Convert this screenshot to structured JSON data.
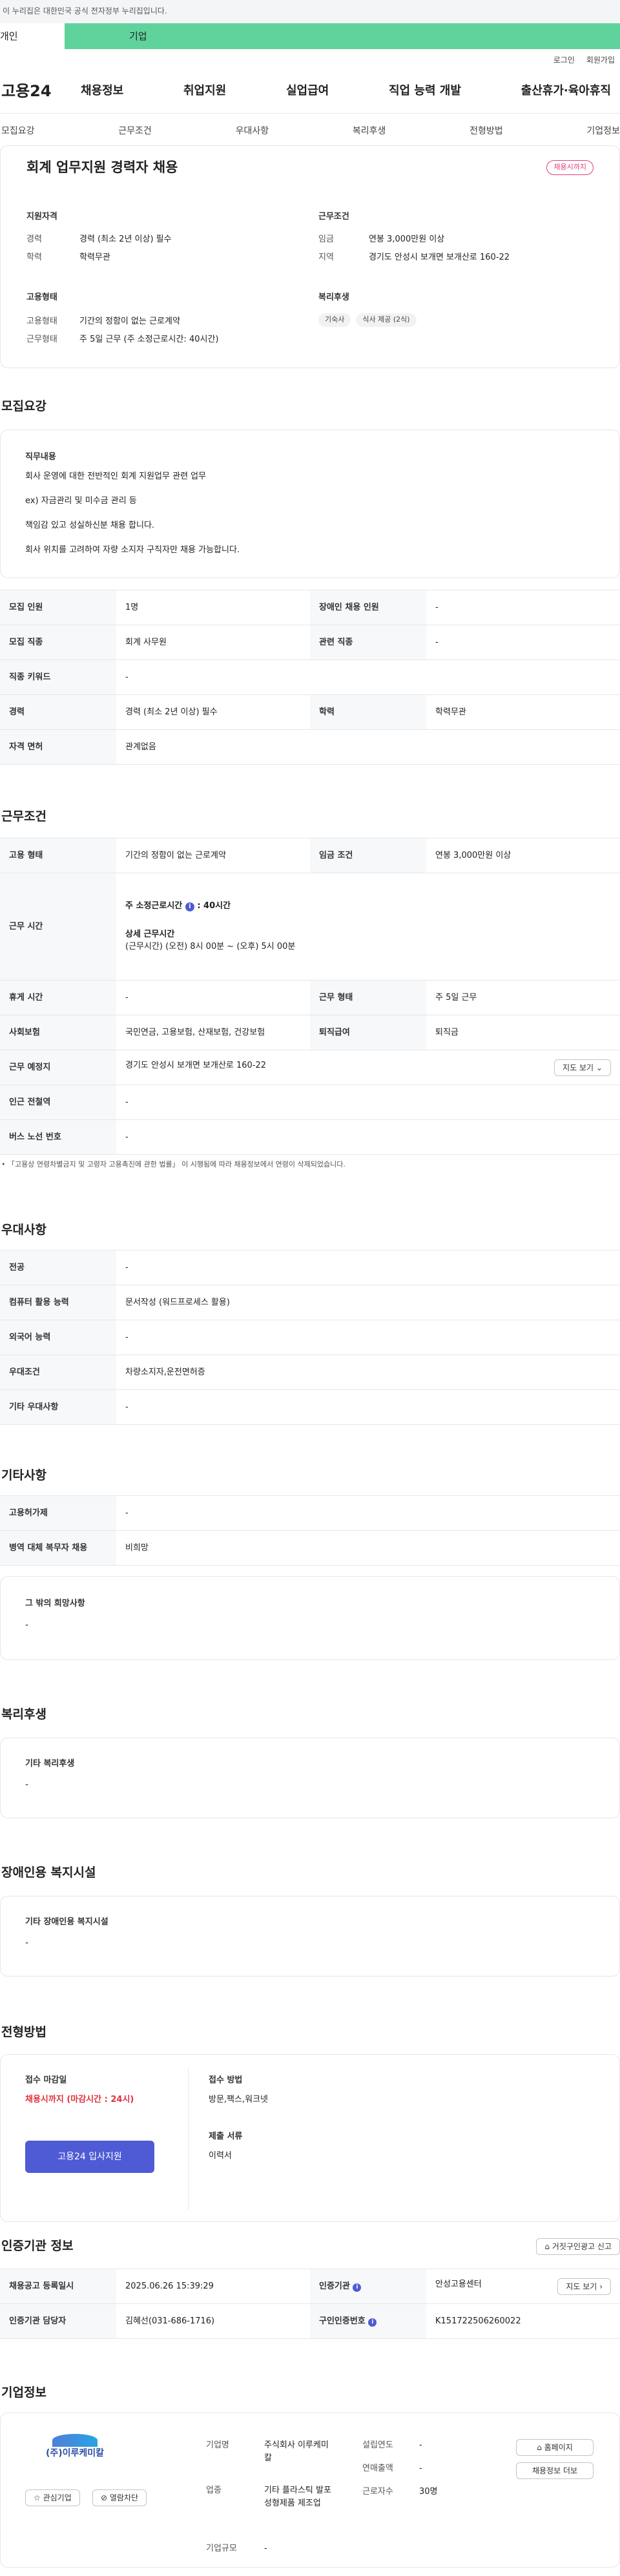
{
  "gov_notice": "이 누리집은 대한민국 공식 전자정부 누리집입니다.",
  "top_tabs": [
    "개인",
    "기업"
  ],
  "util_links": [
    "로그인",
    "회원가입"
  ],
  "logo": "고용24",
  "gnav": [
    "채용정보",
    "취업지원",
    "실업급여",
    "직업 능력 개발",
    "출산휴가·육아휴직"
  ],
  "subnav": [
    "모집요강",
    "근무조건",
    "우대사항",
    "복리후생",
    "전형방법",
    "기업정보"
  ],
  "summary": {
    "title": "회계 업무지원 경력자 채용",
    "badge": "채용시까지",
    "qual_title": "지원자격",
    "career_l": "경력",
    "career_v": "경력 (최소 2년 이상) 필수",
    "edu_l": "학력",
    "edu_v": "학력무관",
    "cond_title": "근무조건",
    "wage_l": "임금",
    "wage_v": "연봉 3,000만원 이상",
    "region_l": "지역",
    "region_v": "경기도 안성시 보개면 보개산로 160-22",
    "emp_title": "고용형태",
    "emptype_l": "고용형태",
    "emptype_v": "기간의 정함이 없는 근로계약",
    "worktype_l": "근무형태",
    "worktype_v": "주 5일 근무 (주 소정근로시간: 40시간)",
    "welfare_title": "복리후생",
    "chips": [
      "기숙사",
      "식사 제공 (2식)"
    ]
  },
  "recruit": {
    "title": "모집요강",
    "job_l": "직무내용",
    "lines": [
      "회사 운영에 대한 전반적인 회계 지원업무 관련 업무",
      "ex) 자금관리 및 미수금 관리 등",
      "책임감 있고 성실하신분 채용 합니다.",
      "회사 위치를 고려하여 자량 소지자 구직자만 채용 가능합니다."
    ],
    "rows": [
      [
        "모집 인원",
        "1명",
        "장애인 채용 인원",
        "-"
      ],
      [
        "모집 직종",
        "회계 사무원",
        "관련 직종",
        "-"
      ],
      [
        "직종 키워드",
        "-"
      ],
      [
        "경력",
        "경력 (최소 2년 이상) 필수",
        "학력",
        "학력무관"
      ],
      [
        "자격 면허",
        "관계없음"
      ]
    ]
  },
  "work": {
    "title": "근무조건",
    "r1": [
      "고용 형태",
      "기간의 정함이 없는 근로계약",
      "임금 조건",
      "연봉 3,000만원 이상"
    ],
    "hours_l": "근무 시간",
    "hours_a": "주 소정근로시간",
    "hours_b": ": 40시간",
    "hours_detail_l": "상세 근무시간",
    "hours_detail_v": "(근무시간) (오전) 8시 00분 ~ (오후) 5시 00분",
    "r3": [
      "휴게 시간",
      "-",
      "근무 형태",
      "주 5일 근무"
    ],
    "r4": [
      "사회보험",
      "국민연금, 고용보험, 산재보험, 건강보험",
      "퇴직급여",
      "퇴직금"
    ],
    "r5": [
      "근무 예정지",
      "경기도 안성시 보개면 보개산로 160-22"
    ],
    "map_btn": "지도 보기",
    "r6": [
      "인근 전철역",
      "-"
    ],
    "r7": [
      "버스 노선 번호",
      "-"
    ],
    "note": "「고용상 연령차별금지 및 고령자 고용촉진에 관한 법률」 이 시행됨에 따라 채용정보에서 연령이 삭제되었습니다."
  },
  "pref": {
    "title": "우대사항",
    "rows": [
      [
        "전공",
        "-"
      ],
      [
        "컴퓨터 활용 능력",
        "문서작성 (워드프로세스 활용)"
      ],
      [
        "외국어 능력",
        "-"
      ],
      [
        "우대조건",
        "차량소지자,운전면허증"
      ],
      [
        "기타 우대사항",
        "-"
      ]
    ]
  },
  "etc": {
    "title": "기타사항",
    "rows": [
      [
        "고용허가제",
        "-"
      ],
      [
        "병역 대체 복무자 채용",
        "비희망"
      ]
    ],
    "hope_t": "그 밖의 희망사항",
    "hope_v": "-"
  },
  "welfare": {
    "title": "복리후생",
    "t": "기타 복리후생",
    "v": "-"
  },
  "disab": {
    "title": "장애인용 복지시설",
    "t": "기타 장애인용 복지시설",
    "v": "-"
  },
  "process": {
    "title": "전형방법",
    "deadline_l": "접수 마감일",
    "deadline_v": "채용시까지 (마감시간 : 24시)",
    "apply_btn": "고용24 입사지원",
    "method_l": "접수 방법",
    "method_v": "방문,팩스,워크넷",
    "docs_l": "제출 서류",
    "docs_v": "이력서"
  },
  "agency": {
    "title": "인증기관 정보",
    "report_btn": "거짓구인광고 신고",
    "r1": [
      "채용공고 등록일시",
      "2025.06.26 15:39:29",
      "인증기관",
      "안성고용센터"
    ],
    "r2": [
      "인증기관 담당자",
      "김혜선(031-686-1716)",
      "구인인증번호",
      "K151722506260022"
    ],
    "map_btn": "지도 보기"
  },
  "company": {
    "title": "기업정보",
    "logo_text": "(주)이루케미칼",
    "fav_btn": "관심기업",
    "block_btn": "열람차단",
    "name_l": "기업명",
    "name_v": "주식회사 이루케미칼",
    "ind_l": "업종",
    "ind_v": "기타 플라스틱 발포 성형제품 제조업",
    "size_l": "기업규모",
    "size_v": "-",
    "year_l": "설립연도",
    "year_v": "-",
    "sales_l": "연매출액",
    "sales_v": "-",
    "emp_l": "근로자수",
    "emp_v": "30명",
    "home_btn": "홈페이지",
    "jobs_btn": "채용정보 더보"
  },
  "colors": {
    "accent": "#4f5bd5",
    "badge": "#e53e7d",
    "red": "#e0323c",
    "green": "#5fd39b"
  }
}
